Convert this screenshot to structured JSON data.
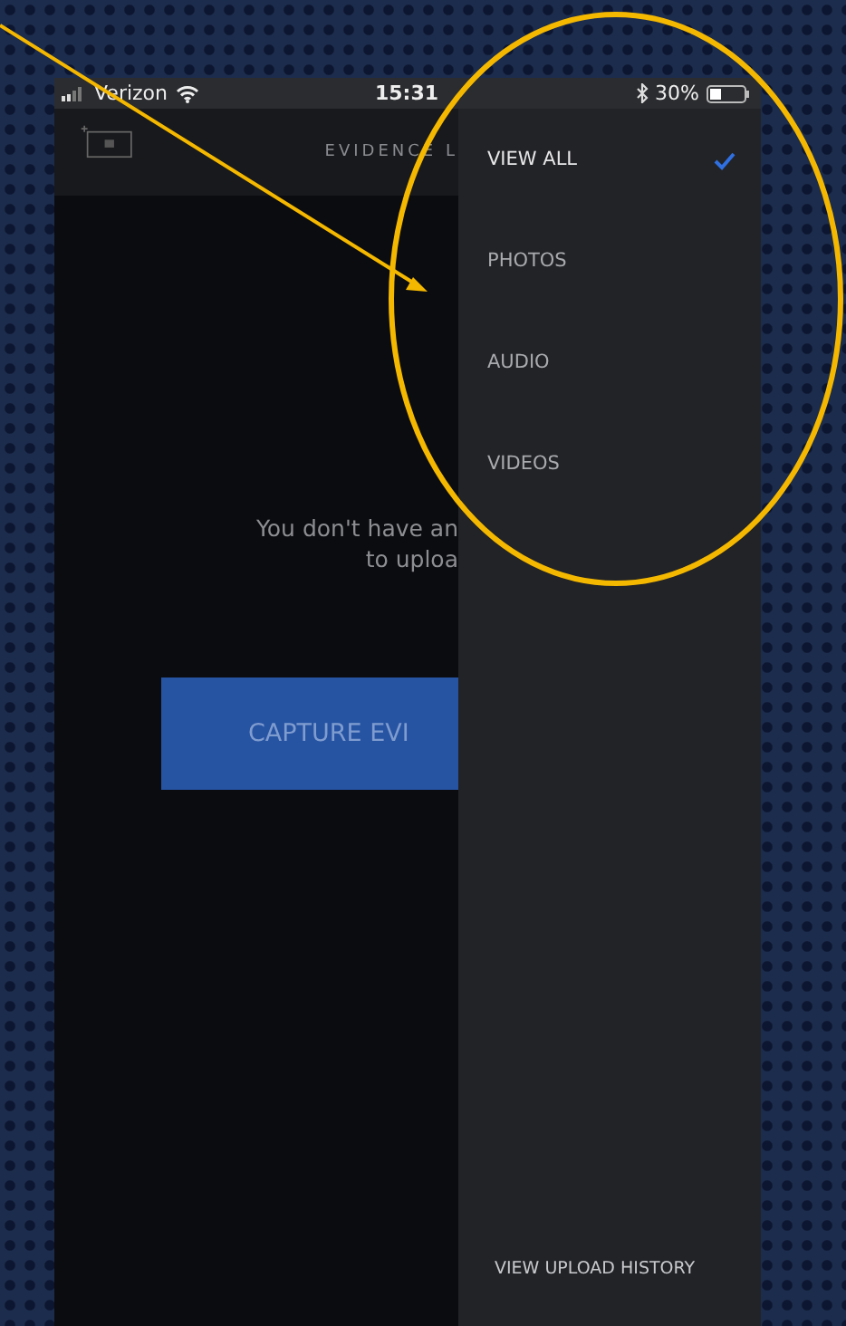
{
  "status_bar": {
    "carrier": "Verizon",
    "time": "15:31",
    "battery": "30%"
  },
  "header": {
    "title": "EVIDENCE L"
  },
  "empty_state": {
    "lines": [
      "You don't have an",
      "to uploa"
    ]
  },
  "capture_button": {
    "label": "CAPTURE EVI"
  },
  "filter_menu": {
    "items": [
      {
        "label": "VIEW ALL",
        "selected": true
      },
      {
        "label": "PHOTOS",
        "selected": false
      },
      {
        "label": "AUDIO",
        "selected": false
      },
      {
        "label": "VIDEOS",
        "selected": false
      }
    ],
    "footer_link": "VIEW UPLOAD HISTORY"
  }
}
